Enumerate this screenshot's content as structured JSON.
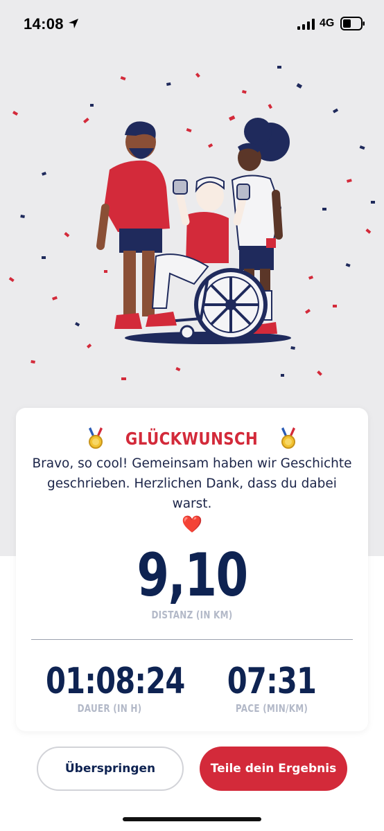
{
  "status_bar": {
    "time": "14:08",
    "network": "4G",
    "icons": [
      "location-arrow-icon",
      "signal-bars-icon",
      "battery-icon"
    ]
  },
  "illustration": {
    "description_icon": "celebration-illustration",
    "colors": {
      "red": "#d32a3a",
      "navy": "#1f2a5c",
      "background": "#ebebed"
    }
  },
  "card": {
    "title": "GLÜCKWUNSCH",
    "message": "Bravo, so cool! Gemeinsam haben wir Geschichte geschrieben. Herzlichen Dank, dass du dabei warst.",
    "emoji": "❤️",
    "distance": {
      "value": "9,10",
      "label": "DISTANZ (IN KM)"
    },
    "duration": {
      "value": "01:08:24",
      "label": "DAUER (IN H)"
    },
    "pace": {
      "value": "07:31",
      "label": "PACE (MIN/KM)"
    }
  },
  "buttons": {
    "skip": "Überspringen",
    "share": "Teile dein Ergebnis"
  },
  "colors": {
    "accent": "#d32a3a",
    "primary_text": "#0e2352",
    "muted_label": "#b3b9c8"
  }
}
